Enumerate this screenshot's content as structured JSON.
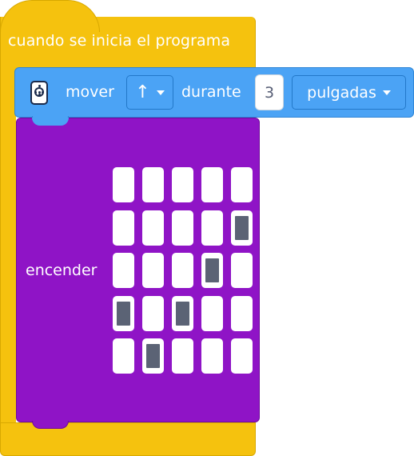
{
  "hat": {
    "label": "cuando se inicia el programa"
  },
  "move": {
    "icon": "hub-icon",
    "label": "mover",
    "direction": "↑",
    "during_label": "durante",
    "amount": "3",
    "unit": "pulgadas"
  },
  "light": {
    "label": "encender",
    "matrix": [
      [
        0,
        0,
        0,
        0,
        0
      ],
      [
        0,
        0,
        0,
        0,
        1
      ],
      [
        0,
        0,
        0,
        1,
        0
      ],
      [
        1,
        0,
        1,
        0,
        0
      ],
      [
        0,
        1,
        0,
        0,
        0
      ]
    ]
  },
  "colors": {
    "event": "#f5c20e",
    "motion": "#4ba3f5",
    "light": "#8f14c6",
    "pixel_on": "#5b6375"
  }
}
